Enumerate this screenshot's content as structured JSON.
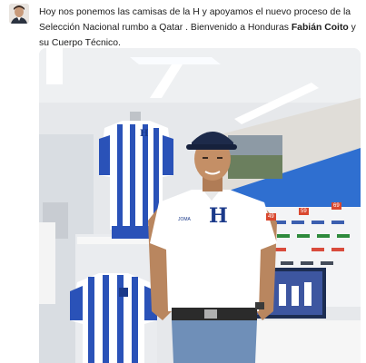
{
  "tweet": {
    "text_part1": "Hoy nos ponemos las camisas de la H y apoyamos el nuevo proceso de la Selección Nacional rumbo a Qatar . Bienvenido a Honduras ",
    "bold_name": "Fabián Coito",
    "text_part2": " y su Cuerpo Técnico."
  },
  "photo": {
    "shirt_letter": "H",
    "mannequin_shirt_letter": "H",
    "brand_mark": "JOMA",
    "shelf_price_tags": [
      "49",
      "59",
      "69"
    ]
  },
  "colors": {
    "shirt_blue": "#2a52b8",
    "wall_blue": "#2a6bd1",
    "cap_navy": "#1d2a4a"
  },
  "icons": {
    "avatar": "user-avatar",
    "shirt": "jersey-icon"
  }
}
